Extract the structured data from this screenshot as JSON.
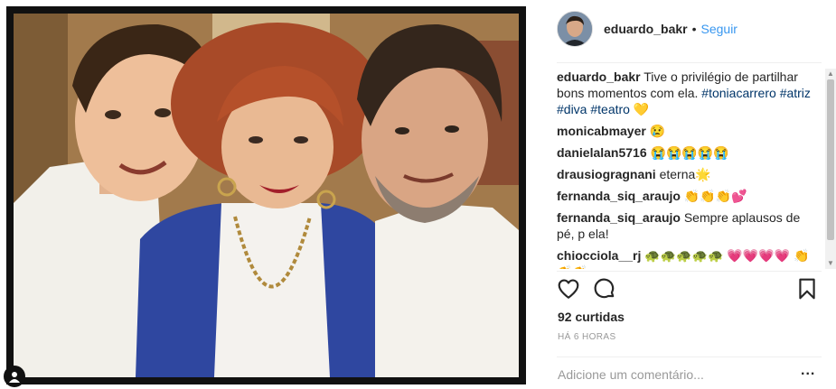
{
  "post": {
    "username": "eduardo_bakr",
    "separator": "•",
    "follow_label": "Seguir",
    "caption_prefix": "Tive o privilégio de partilhar bons momentos com ela.",
    "caption_tags": [
      "#toniacarrero",
      "#atriz",
      "#diva",
      "#teatro"
    ],
    "caption_emoji": "💛",
    "likes": "92 curtidas",
    "time": "HÁ 6 HORAS",
    "comment_placeholder": "Adicione um comentário...",
    "more_label": "..."
  },
  "comments": [
    {
      "user": "monicabmayer",
      "text": "😢"
    },
    {
      "user": "danielalan5716",
      "text": "😭😭😭😭😭"
    },
    {
      "user": "drausiogragnani",
      "text": "eterna🌟"
    },
    {
      "user": "fernanda_siq_araujo",
      "text": "👏👏👏💕"
    },
    {
      "user": "fernanda_siq_araujo",
      "text": "Sempre aplausos de pé, p ela!"
    },
    {
      "user": "chiocciola__rj",
      "text": "🐢🐢🐢🐢🐢 💗💗💗💗 👏👏👏"
    }
  ],
  "icons": {
    "like": "heart-outline-icon",
    "comment": "speech-bubble-icon",
    "save": "bookmark-icon",
    "tag": "user-tag-icon"
  },
  "colors": {
    "link": "#3897f0",
    "hashtag": "#003569",
    "text": "#262626",
    "muted": "#999999"
  }
}
